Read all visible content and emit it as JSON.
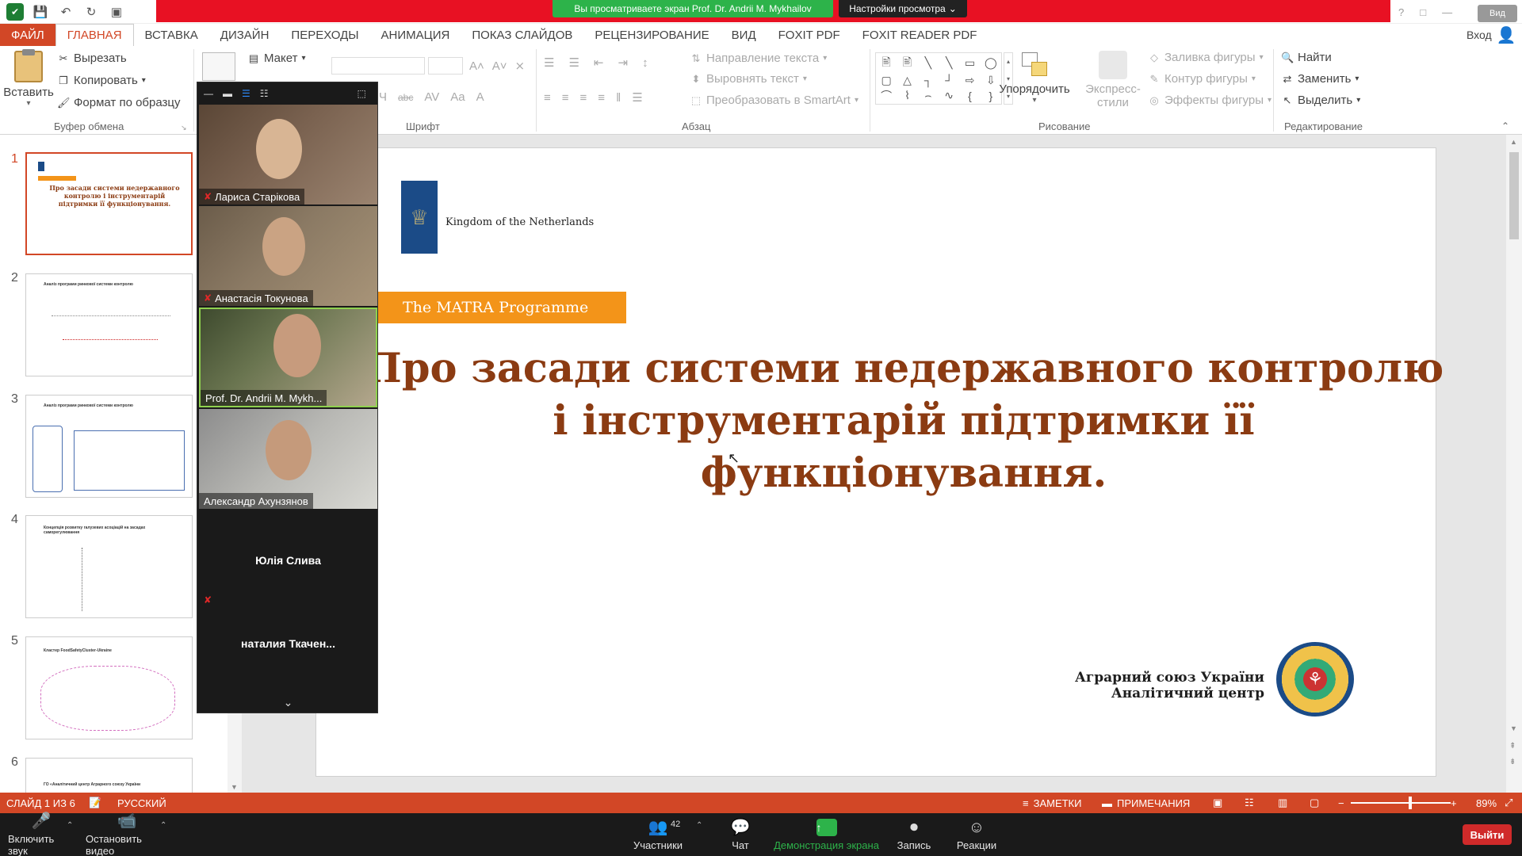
{
  "titlebar": {
    "viewing_banner": "Вы просматриваете экран Prof. Dr. Andrii M. Mykhailov",
    "view_settings": "Настройки просмотра",
    "view_badge": "Вид"
  },
  "tabs": [
    "ФАЙЛ",
    "ГЛАВНАЯ",
    "ВСТАВКА",
    "ДИЗАЙН",
    "ПЕРЕХОДЫ",
    "АНИМАЦИЯ",
    "ПОКАЗ СЛАЙДОВ",
    "РЕЦЕНЗИРОВАНИЕ",
    "ВИД",
    "FOXIT PDF",
    "FOXIT READER PDF"
  ],
  "login": "Вход",
  "ribbon": {
    "clipboard": {
      "paste": "Вставить",
      "cut": "Вырезать",
      "copy": "Копировать",
      "format_painter": "Формат по образцу",
      "label": "Буфер обмена"
    },
    "slides": {
      "layout": "Макет"
    },
    "font": {
      "label": "Шрифт"
    },
    "paragraph": {
      "text_direction": "Направление текста",
      "align_text": "Выровнять текст",
      "smartart": "Преобразовать в SmartArt",
      "label": "Абзац"
    },
    "drawing": {
      "arrange": "Упорядочить",
      "quick_styles_1": "Экспресс-",
      "quick_styles_2": "стили",
      "shape_fill": "Заливка фигуры",
      "shape_outline": "Контур фигуры",
      "shape_effects": "Эффекты фигуры",
      "label": "Рисование"
    },
    "editing": {
      "find": "Найти",
      "replace": "Заменить",
      "select": "Выделить",
      "label": "Редактирование"
    }
  },
  "thumbnails": [
    {
      "num": "1",
      "title": "Про засади системи недержавного контролю і інструментарій підтримки її функціонування."
    },
    {
      "num": "2",
      "title": "Аналіз програми ринкової системи контролю"
    },
    {
      "num": "3",
      "title": "Аналіз програми ринкової системи контролю"
    },
    {
      "num": "4",
      "title": "Концепція розвитку галузевих асоціацій на засадах саморегулювання"
    },
    {
      "num": "5",
      "title": "Кластер FoodSafetyCluster-Ukraine"
    },
    {
      "num": "6",
      "title": "ГО «Аналітичний центр Аграрного союзу України"
    }
  ],
  "slide": {
    "nl_text": "Kingdom of the Netherlands",
    "matra": "The MATRA Programme",
    "title": "Про засади системи недержавного контролю і інструментарій підтримки її функціонування.",
    "org_line1": "Аграрний союз України",
    "org_line2": "Аналітичний центр"
  },
  "participants": [
    {
      "name": "Лариса Старікова",
      "muted": true
    },
    {
      "name": "Анастасія Токунова",
      "muted": true
    },
    {
      "name": "Prof. Dr. Andrii M. Mykh...",
      "muted": false
    },
    {
      "name": "Александр Ахунзянов",
      "muted": false
    },
    {
      "name": "Юлія Слива",
      "muted": true
    },
    {
      "name": "наталия  Ткачен...",
      "muted": true
    }
  ],
  "status": {
    "slide_of": "СЛАЙД 1 ИЗ 6",
    "language": "РУССКИЙ",
    "notes": "ЗАМЕТКИ",
    "comments": "ПРИМЕЧАНИЯ",
    "zoom": "89%",
    "zoom_fraction": 0.6
  },
  "zoom_controls": {
    "mute": "Включить звук",
    "video": "Остановить видео",
    "participants": "Участники",
    "participants_count": "42",
    "chat": "Чат",
    "share": "Демонстрация экрана",
    "record": "Запись",
    "reactions": "Реакции",
    "exit": "Выйти"
  },
  "colors": {
    "accent": "#d24726",
    "share_green": "#2db34a",
    "title_brown": "#8b3b12",
    "matra_orange": "#f39419",
    "exit_red": "#d02a2a"
  }
}
